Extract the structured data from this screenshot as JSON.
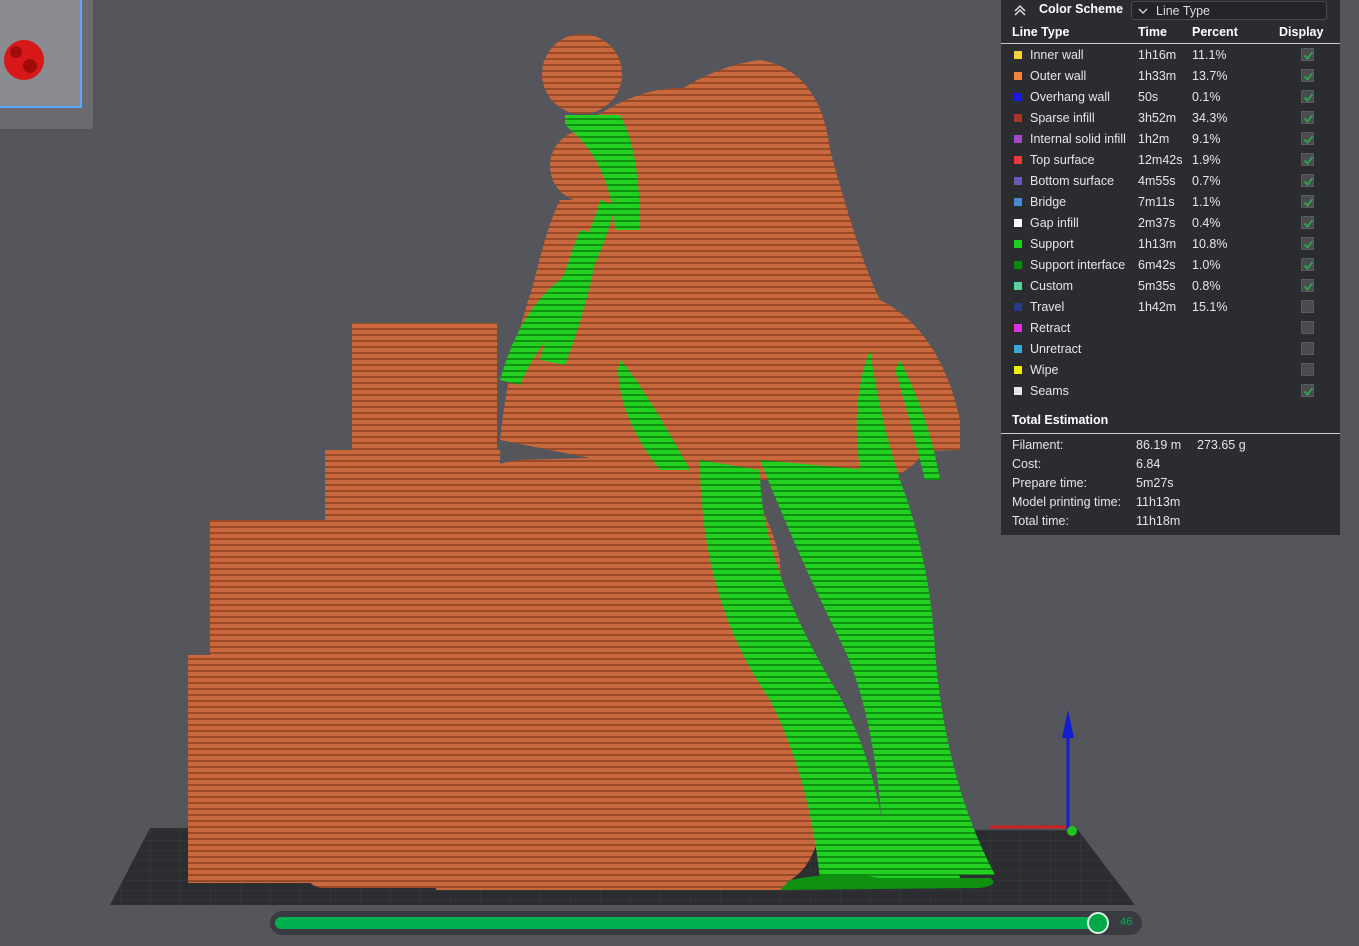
{
  "legend": {
    "title": "Color Scheme",
    "scheme_value": "Line Type",
    "headers": {
      "line_type": "Line Type",
      "time": "Time",
      "percent": "Percent",
      "display": "Display"
    },
    "rows": [
      {
        "label": "Inner wall",
        "time": "1h16m",
        "percent": "11.1%",
        "color": "#f4d33c",
        "checked": true
      },
      {
        "label": "Outer wall",
        "time": "1h33m",
        "percent": "13.7%",
        "color": "#f4823a",
        "checked": true
      },
      {
        "label": "Overhang wall",
        "time": "50s",
        "percent": "0.1%",
        "color": "#1818f0",
        "checked": true
      },
      {
        "label": "Sparse infill",
        "time": "3h52m",
        "percent": "34.3%",
        "color": "#b0302c",
        "checked": true
      },
      {
        "label": "Internal solid infill",
        "time": "1h2m",
        "percent": "9.1%",
        "color": "#a04ac8",
        "checked": true
      },
      {
        "label": "Top surface",
        "time": "12m42s",
        "percent": "1.9%",
        "color": "#f03a3a",
        "checked": true
      },
      {
        "label": "Bottom surface",
        "time": "4m55s",
        "percent": "0.7%",
        "color": "#6a5ab8",
        "checked": true
      },
      {
        "label": "Bridge",
        "time": "7m11s",
        "percent": "1.1%",
        "color": "#4a8ad0",
        "checked": true
      },
      {
        "label": "Gap infill",
        "time": "2m37s",
        "percent": "0.4%",
        "color": "#ffffff",
        "checked": true
      },
      {
        "label": "Support",
        "time": "1h13m",
        "percent": "10.8%",
        "color": "#1ad01a",
        "checked": true
      },
      {
        "label": "Support interface",
        "time": "6m42s",
        "percent": "1.0%",
        "color": "#0a8a0a",
        "checked": true
      },
      {
        "label": "Custom",
        "time": "5m35s",
        "percent": "0.8%",
        "color": "#5ad0a0",
        "checked": true
      },
      {
        "label": "Travel",
        "time": "1h42m",
        "percent": "15.1%",
        "color": "#2a3a8a",
        "checked": false
      },
      {
        "label": "Retract",
        "time": "",
        "percent": "",
        "color": "#e030e0",
        "checked": false
      },
      {
        "label": "Unretract",
        "time": "",
        "percent": "",
        "color": "#3aa8d8",
        "checked": false
      },
      {
        "label": "Wipe",
        "time": "",
        "percent": "",
        "color": "#f0f000",
        "checked": false
      },
      {
        "label": "Seams",
        "time": "",
        "percent": "",
        "color": "#e8e8e8",
        "checked": true
      }
    ],
    "total_title": "Total Estimation",
    "estimation": [
      {
        "key": "Filament:",
        "value": "86.19 m",
        "value2": "273.65 g"
      },
      {
        "key": "Cost:",
        "value": "6.84",
        "value2": ""
      },
      {
        "key": "Prepare time:",
        "value": "5m27s",
        "value2": ""
      },
      {
        "key": "Model printing time:",
        "value": "11h13m",
        "value2": ""
      },
      {
        "key": "Total time:",
        "value": "11h18m",
        "value2": ""
      }
    ]
  },
  "slider": {
    "value": "46",
    "fill_fraction": 0.95
  },
  "colors": {
    "model": "#c8643a",
    "support": "#1ec81e",
    "accent": "#00b050"
  }
}
